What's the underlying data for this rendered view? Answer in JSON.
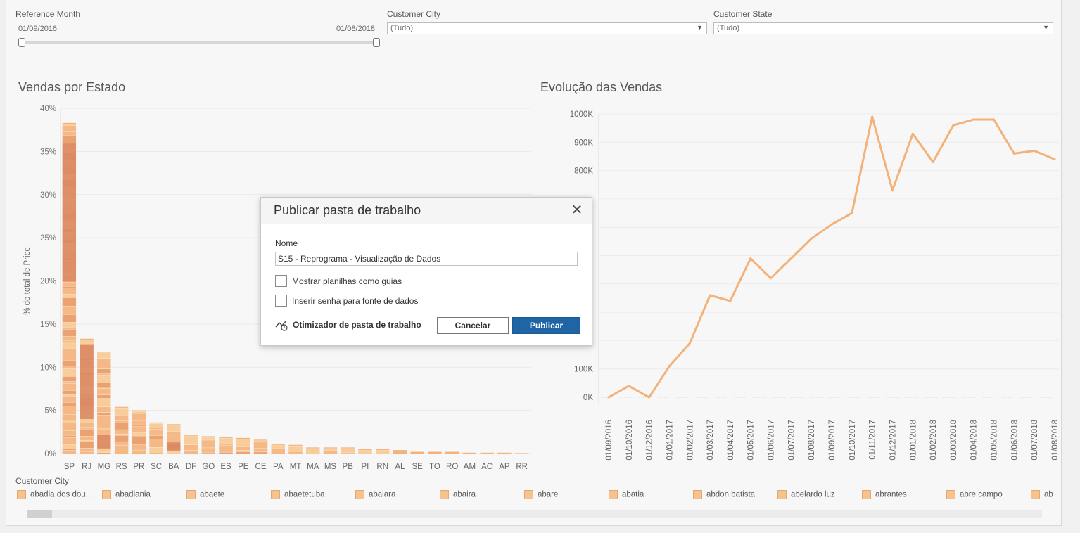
{
  "filters": {
    "reference_month": {
      "label": "Reference Month",
      "start": "01/09/2016",
      "end": "01/08/2018"
    },
    "customer_city": {
      "label": "Customer City",
      "value": "(Tudo)"
    },
    "customer_state": {
      "label": "Customer State",
      "value": "(Tudo)"
    }
  },
  "colors": {
    "bar_base": "#f2b27a",
    "bar_dark": "#d98761",
    "line": "#f2b27a",
    "publish_button": "#1f65a5"
  },
  "chart_data": [
    {
      "type": "bar",
      "title": "Vendas por Estado",
      "ylabel": "% do total de Price",
      "categories": [
        "SP",
        "RJ",
        "MG",
        "RS",
        "PR",
        "SC",
        "BA",
        "DF",
        "GO",
        "ES",
        "PE",
        "CE",
        "PA",
        "MT",
        "MA",
        "MS",
        "PB",
        "PI",
        "RN",
        "AL",
        "SE",
        "TO",
        "RO",
        "AM",
        "AC",
        "AP",
        "RR"
      ],
      "values": [
        38.3,
        13.3,
        11.8,
        5.4,
        5.0,
        3.6,
        3.4,
        2.1,
        2.0,
        1.9,
        1.8,
        1.6,
        1.1,
        1.0,
        0.7,
        0.7,
        0.7,
        0.5,
        0.5,
        0.4,
        0.2,
        0.2,
        0.2,
        0.1,
        0.1,
        0.1,
        0.05
      ],
      "yticks": [
        "0%",
        "5%",
        "10%",
        "15%",
        "20%",
        "25%",
        "30%",
        "35%",
        "40%"
      ],
      "ylim": [
        0,
        40
      ],
      "grid": true
    },
    {
      "type": "line",
      "title": "Evolução das Vendas",
      "x": [
        "01/09/2016",
        "01/10/2016",
        "01/12/2016",
        "01/01/2017",
        "01/02/2017",
        "01/03/2017",
        "01/04/2017",
        "01/05/2017",
        "01/06/2017",
        "01/07/2017",
        "01/08/2017",
        "01/09/2017",
        "01/10/2017",
        "01/11/2017",
        "01/12/2017",
        "01/01/2018",
        "01/02/2018",
        "01/03/2018",
        "01/04/2018",
        "01/05/2018",
        "01/06/2018",
        "01/07/2018",
        "01/08/2018"
      ],
      "values": [
        0,
        40000,
        0,
        110000,
        190000,
        360000,
        340000,
        490000,
        420000,
        490000,
        560000,
        610000,
        650000,
        990000,
        730000,
        930000,
        830000,
        960000,
        980000,
        980000,
        860000,
        870000,
        840000
      ],
      "yticks_visible": [
        "0K",
        "100K",
        "800K",
        "900K",
        "1000K"
      ],
      "ylim": [
        0,
        1000000
      ],
      "grid": true
    }
  ],
  "legend": {
    "title": "Customer City",
    "items": [
      "abadia dos dou...",
      "abadiania",
      "abaete",
      "abaetetuba",
      "abaiara",
      "abaira",
      "abare",
      "abatia",
      "abdon batista",
      "abelardo luz",
      "abrantes",
      "abre campo",
      "ab"
    ]
  },
  "dialog": {
    "title": "Publicar pasta de trabalho",
    "name_label": "Nome",
    "name_value": "S15 - Reprograma - Visualização de Dados",
    "checkbox_sheets": "Mostrar planilhas como guias",
    "checkbox_password": "Inserir senha para fonte de dados",
    "optimizer": "Otimizador de pasta de trabalho",
    "cancel": "Cancelar",
    "publish": "Publicar"
  }
}
